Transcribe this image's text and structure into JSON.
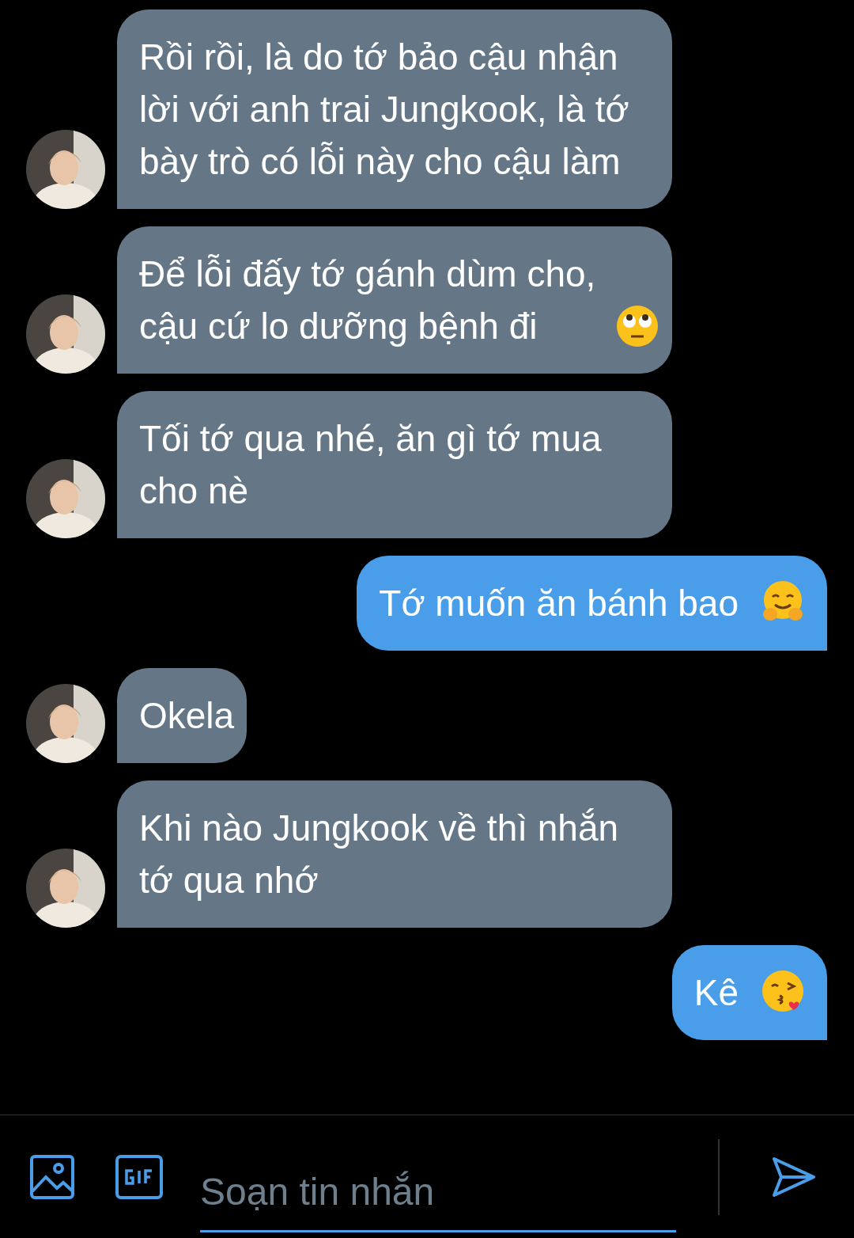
{
  "messages": [
    {
      "kind": "received",
      "text": "Rồi rồi, là do tớ bảo cậu nhận lời với anh trai Jungkook, là tớ bày trò có lỗi này cho cậu làm"
    },
    {
      "kind": "received-eyeroll",
      "text": "Để lỗi đấy tớ gánh dùm cho, cậu cứ lo dưỡng bệnh đi"
    },
    {
      "kind": "received",
      "text": "Tối tớ qua nhé, ăn gì tớ mua cho nè"
    },
    {
      "kind": "sent-hug",
      "text": "Tớ muốn ăn bánh bao"
    },
    {
      "kind": "received",
      "text": "Okela"
    },
    {
      "kind": "received",
      "text": "Khi nào Jungkook về thì nhắn tớ qua nhớ"
    },
    {
      "kind": "sent-kiss",
      "text": "Kê"
    }
  ],
  "composer": {
    "placeholder": "Soạn tin nhắn"
  }
}
